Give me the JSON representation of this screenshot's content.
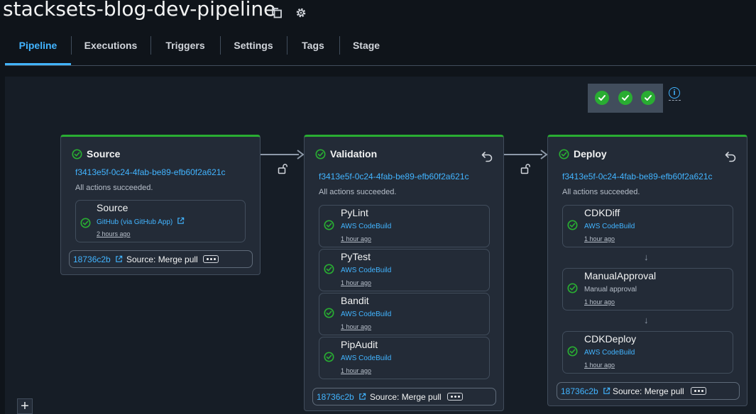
{
  "header": {
    "title": "stacksets-blog-dev-pipeline",
    "copy_icon": "copy-icon",
    "settings_icon": "gear-icon"
  },
  "tabs": [
    {
      "label": "Pipeline",
      "active": true
    },
    {
      "label": "Executions"
    },
    {
      "label": "Triggers"
    },
    {
      "label": "Settings"
    },
    {
      "label": "Tags"
    },
    {
      "label": "Stage"
    }
  ],
  "status_summary": {
    "icons": [
      "success-check-icon",
      "success-check-icon",
      "success-check-icon"
    ],
    "info_label": "i"
  },
  "colors": {
    "success": "#29ad32",
    "link": "#42b4ff",
    "panel": "#232b37"
  },
  "stages": [
    {
      "name": "Source",
      "execution_id": "f3413e5f-0c24-4fab-be89-efb60f2a621c",
      "message": "All actions succeeded.",
      "actions": [
        {
          "name": "Source",
          "provider": "GitHub (via GitHub App)",
          "time": "2 hours ago"
        }
      ],
      "footer": {
        "commit": "18736c2b",
        "message": "Source: Merge pull"
      }
    },
    {
      "name": "Validation",
      "execution_id": "f3413e5f-0c24-4fab-be89-efb60f2a621c",
      "message": "All actions succeeded.",
      "actions": [
        {
          "name": "PyLint",
          "provider": "AWS CodeBuild",
          "time": "1 hour ago"
        },
        {
          "name": "PyTest",
          "provider": "AWS CodeBuild",
          "time": "1 hour ago"
        },
        {
          "name": "Bandit",
          "provider": "AWS CodeBuild",
          "time": "1 hour ago"
        },
        {
          "name": "PipAudit",
          "provider": "AWS CodeBuild",
          "time": "1 hour ago"
        }
      ],
      "footer": {
        "commit": "18736c2b",
        "message": "Source: Merge pull"
      }
    },
    {
      "name": "Deploy",
      "execution_id": "f3413e5f-0c24-4fab-be89-efb60f2a621c",
      "message": "All actions succeeded.",
      "actions": [
        {
          "name": "CDKDiff",
          "provider": "AWS CodeBuild",
          "time": "1 hour ago"
        },
        {
          "name": "ManualApproval",
          "provider": "Manual approval",
          "time": "1 hour ago"
        },
        {
          "name": "CDKDeploy",
          "provider": "AWS CodeBuild",
          "time": "1 hour ago"
        }
      ],
      "footer": {
        "commit": "18736c2b",
        "message": "Source: Merge pull"
      }
    }
  ],
  "canvas": {
    "zoom_button": "+"
  }
}
